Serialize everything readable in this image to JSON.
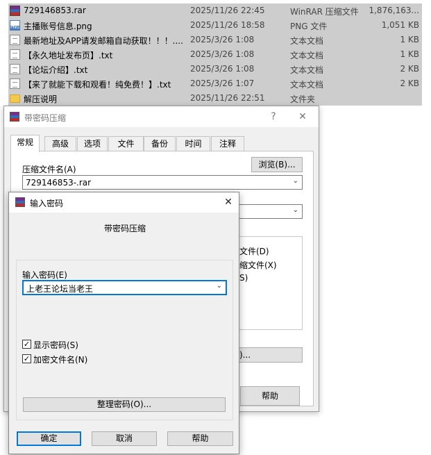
{
  "files": [
    {
      "name": "729146853.rar",
      "date": "2025/11/26 22:45",
      "type": "WinRAR 压缩文件",
      "size": "1,876,163...",
      "icon": "rar-icon",
      "selected": true
    },
    {
      "name": "主播账号信息.png",
      "date": "2025/11/26 18:58",
      "type": "PNG 文件",
      "size": "1,051 KB",
      "icon": "png-icon",
      "selected": true
    },
    {
      "name": "最新地址及APP请发邮箱自动获取！！！....",
      "date": "2025/3/26 1:08",
      "type": "文本文档",
      "size": "1 KB",
      "icon": "txt-icon",
      "selected": true
    },
    {
      "name": "【永久地址发布页】.txt",
      "date": "2025/3/26 1:08",
      "type": "文本文档",
      "size": "1 KB",
      "icon": "txt-icon",
      "selected": true
    },
    {
      "name": "【论坛介绍】.txt",
      "date": "2025/3/26 1:08",
      "type": "文本文档",
      "size": "2 KB",
      "icon": "txt-icon",
      "selected": true
    },
    {
      "name": "【来了就能下载和观看！纯免费！】.txt",
      "date": "2025/3/26 1:07",
      "type": "文本文档",
      "size": "2 KB",
      "icon": "txt-icon",
      "selected": true
    },
    {
      "name": "解压说明",
      "date": "2025/11/26 22:51",
      "type": "文件夹",
      "size": "",
      "icon": "folder-icon",
      "selected": true
    }
  ],
  "archive_dialog": {
    "title": "带密码压缩",
    "help_glyph": "?",
    "close_glyph": "✕",
    "tabs": [
      "常规",
      "高级",
      "选项",
      "文件",
      "备份",
      "时间",
      "注释"
    ],
    "archive_name_label": "压缩文件名(A)",
    "browse_label": "浏览(B)...",
    "archive_name_value": "729146853-.rar",
    "partial_opt1": "文件(D)",
    "partial_opt2": "缩文件(X)",
    "partial_opt3": "S)",
    "partial_btn": ")...",
    "help_label": "帮助"
  },
  "password_dialog": {
    "title": "输入密码",
    "close_glyph": "✕",
    "heading": "带密码压缩",
    "enter_label": "输入密码(E)",
    "password_value": "上老王论坛当老王",
    "show_password_label": "显示密码(S)",
    "show_password_checked": true,
    "encrypt_names_label": "加密文件名(N)",
    "encrypt_names_checked": true,
    "organize_label": "整理密码(O)...",
    "ok_label": "确定",
    "cancel_label": "取消",
    "help_label": "帮助",
    "check_glyph": "✓"
  }
}
